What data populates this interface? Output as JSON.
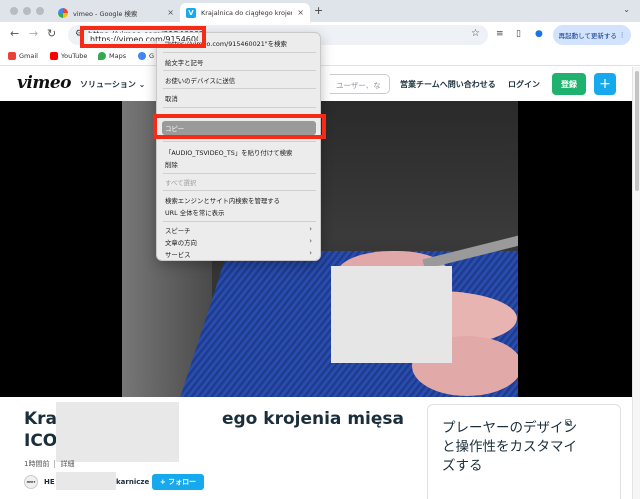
{
  "browser": {
    "tabs": [
      {
        "title": "vimeo - Google 検索",
        "icon": "google-icon",
        "active": false
      },
      {
        "title": "Krajalnica do ciągłego krojenia",
        "icon": "vimeo-icon",
        "active": true
      }
    ],
    "new_tab_glyph": "+",
    "url": "https://vimeo.com/91546002",
    "relaunch_label": "再起動して更新する",
    "relaunch_menu_glyph": "⋮",
    "bookmarks": [
      {
        "label": "Gmail",
        "icon": "gmail-icon",
        "color": "#ea4335"
      },
      {
        "label": "YouTube",
        "icon": "youtube-icon",
        "color": "#ff0000"
      },
      {
        "label": "Maps",
        "icon": "maps-icon",
        "color": "#34a853"
      },
      {
        "label": "G",
        "icon": "google-icon",
        "color": "#4285f4"
      }
    ]
  },
  "context_menu": {
    "items": [
      {
        "label": "\"https://vimeo.com/915460021\"を検索",
        "enabled": true
      },
      {
        "label": "絵文字と記号",
        "enabled": true
      },
      {
        "label": "お使いのデバイスに送信",
        "enabled": true
      },
      {
        "label": "取消",
        "enabled": true
      },
      {
        "label": "コピー",
        "enabled": true,
        "highlighted": true
      },
      {
        "label": "「AUDIO_TSVIDEO_TS」を貼り付けて検索",
        "enabled": true
      },
      {
        "label": "削除",
        "enabled": true
      },
      {
        "label": "すべて選択",
        "enabled": false
      },
      {
        "label": "検索エンジンとサイト内検索を管理する",
        "enabled": true
      },
      {
        "label": "URL 全体を常に表示",
        "enabled": true
      },
      {
        "label": "スピーチ",
        "enabled": true,
        "submenu": true
      },
      {
        "label": "文章の方向",
        "enabled": true,
        "submenu": true
      },
      {
        "label": "サービス",
        "enabled": true,
        "submenu": true
      }
    ]
  },
  "vimeo": {
    "logo": "vimeo",
    "nav": {
      "solutions": "ソリューション",
      "contact_sales": "営業チームへ問い合わせる",
      "login": "ログイン",
      "join": "登録",
      "plus": "+"
    },
    "search_placeholder": "ユーザー、な",
    "video": {
      "title_line1_left": "Kra",
      "title_line1_right": "ego krojenia mięsa",
      "title_line2": "ICO",
      "posted": "1時間前",
      "details": "詳細",
      "owner_avatar": "HERT",
      "owner_prefix": "HE",
      "owner_suffix": "karnicze",
      "follow": "+ フォロー"
    },
    "promo": {
      "text": "プレーヤーのデザインと操作性をカスタマイズする"
    }
  },
  "colors": {
    "highlight_red": "#f52a17",
    "vimeo_green": "#1fb26e",
    "vimeo_blue": "#17a9ee"
  }
}
